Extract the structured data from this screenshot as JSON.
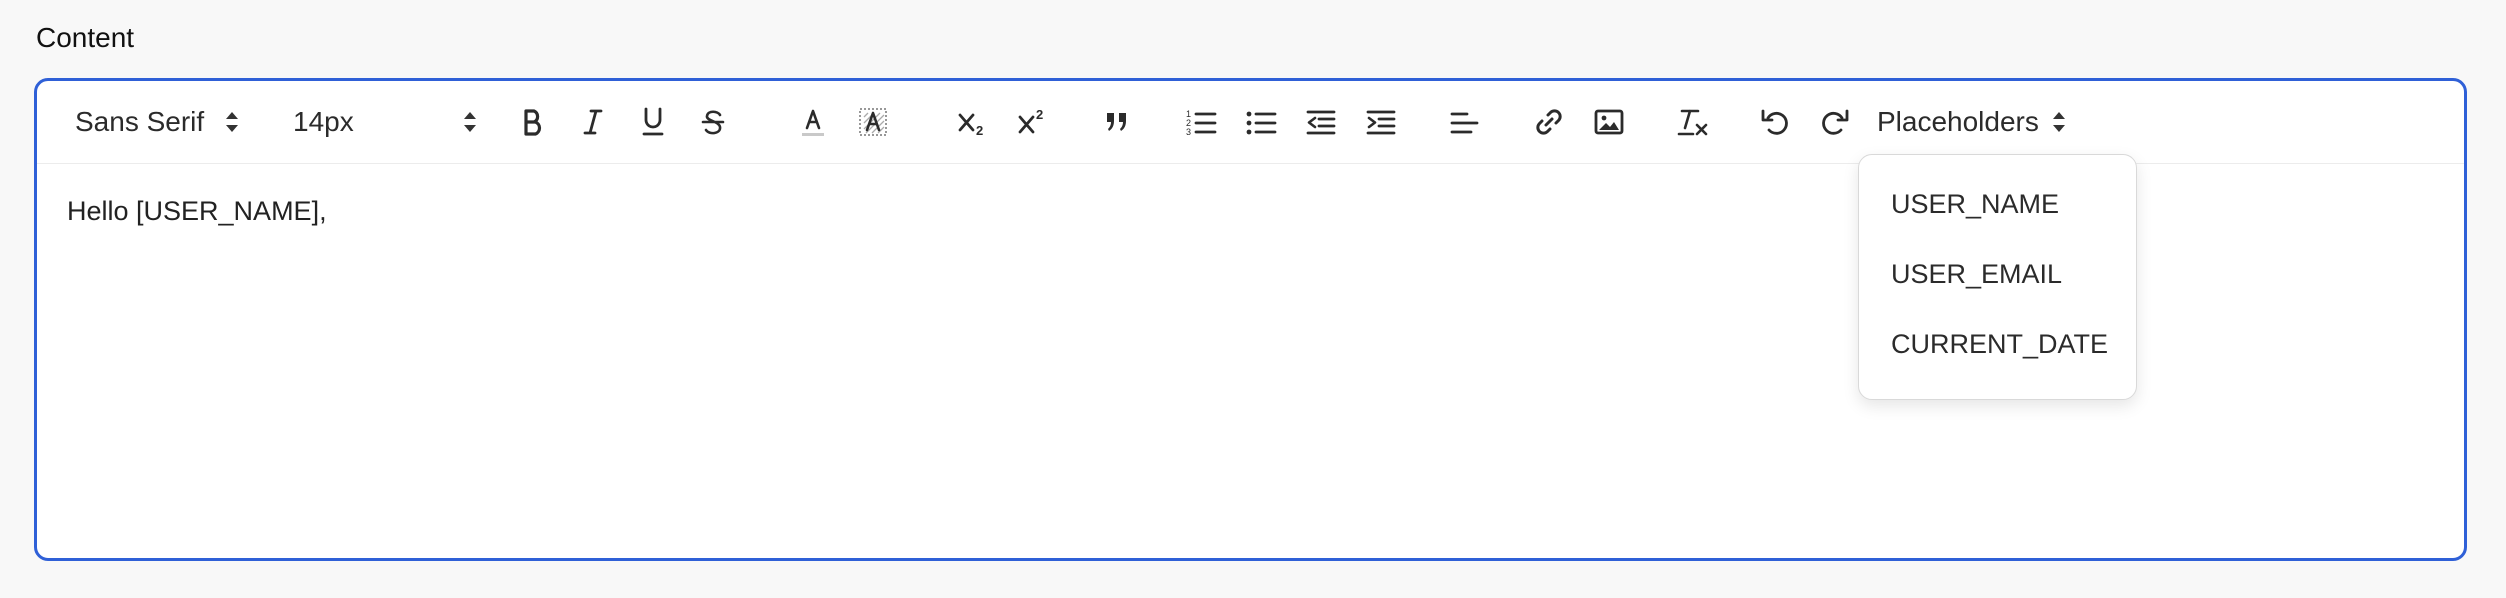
{
  "field": {
    "label": "Content"
  },
  "toolbar": {
    "font_family": "Sans Serif",
    "font_size": "14px",
    "placeholders_label": "Placeholders",
    "icons": [
      "bold-icon",
      "italic-icon",
      "underline-icon",
      "strikethrough-icon",
      "text-color-icon",
      "background-color-icon",
      "subscript-icon",
      "superscript-icon",
      "blockquote-icon",
      "ordered-list-icon",
      "bullet-list-icon",
      "outdent-icon",
      "indent-icon",
      "align-left-icon",
      "link-icon",
      "image-icon",
      "clear-format-icon",
      "undo-icon",
      "redo-icon"
    ]
  },
  "editor": {
    "text": "Hello [USER_NAME],"
  },
  "placeholder_menu": {
    "items": [
      "USER_NAME",
      "USER_EMAIL",
      "CURRENT_DATE"
    ]
  }
}
